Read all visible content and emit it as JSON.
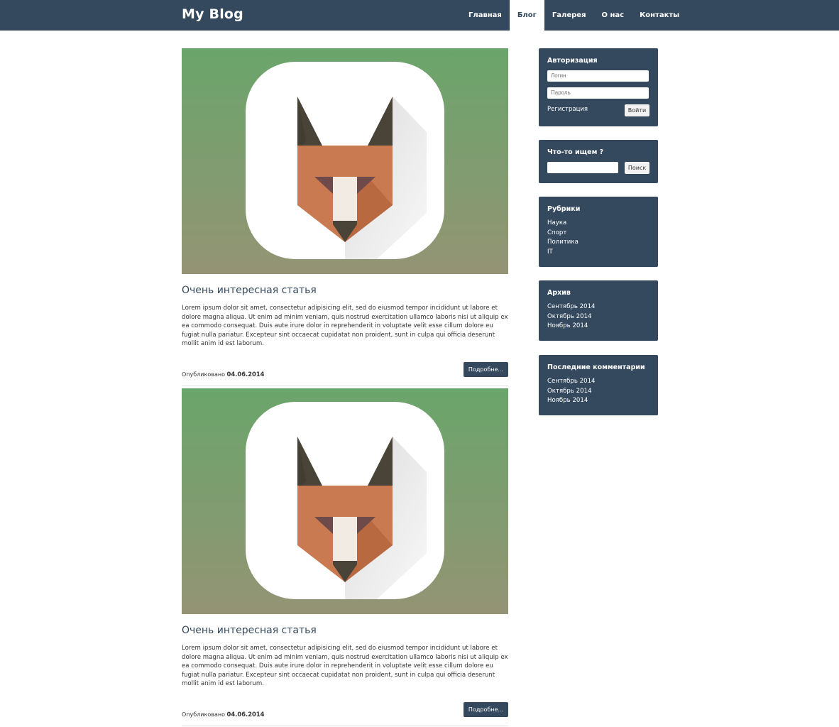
{
  "header": {
    "brand": "My Blog",
    "nav": [
      {
        "label": "Главная",
        "active": false
      },
      {
        "label": "Блог",
        "active": true
      },
      {
        "label": "Галерея",
        "active": false
      },
      {
        "label": "О нас",
        "active": false
      },
      {
        "label": "Контакты",
        "active": false
      }
    ]
  },
  "posts": [
    {
      "title": "Очень интересная статья",
      "text": "Lorem ipsum dolor sit amet, consectetur adipisicing elit, sed do eiusmod tempor incididunt ut labore et dolore magna aliqua. Ut enim ad minim veniam, quis nostrud exercitation ullamco laboris nisi ut aliquip ex ea commodo consequat. Duis aute irure dolor in reprehenderit in voluptate velit esse cillum dolore eu fugiat nulla pariatur. Excepteur sint occaecat cupidatat non proident, sunt in culpa qui officia deserunt mollit anim id est laborum.",
      "published_label": "Опубликовано",
      "date": "04.06.2014",
      "more_label": "Подробне..."
    },
    {
      "title": "Очень интересная статья",
      "text": "Lorem ipsum dolor sit amet, consectetur adipisicing elit, sed do eiusmod tempor incididunt ut labore et dolore magna aliqua. Ut enim ad minim veniam, quis nostrud exercitation ullamco laboris nisi ut aliquip ex ea commodo consequat. Duis aute irure dolor in reprehenderit in voluptate velit esse cillum dolore eu fugiat nulla pariatur. Excepteur sint occaecat cupidatat non proident, sunt in culpa qui officia deserunt mollit anim id est laborum.",
      "published_label": "Опубликовано",
      "date": "04.06.2014",
      "more_label": "Подробне..."
    }
  ],
  "sidebar": {
    "auth": {
      "title": "Авторизация",
      "login_placeholder": "Логин",
      "password_placeholder": "Пароль",
      "register_label": "Регистрация",
      "submit_label": "Войти"
    },
    "search": {
      "title": "Что-то ищем ?",
      "button_label": "Поиск"
    },
    "categories": {
      "title": "Рубрики",
      "items": [
        "Наука",
        "Спорт",
        "Политика",
        "IT"
      ]
    },
    "archive": {
      "title": "Архив",
      "items": [
        "Сентябрь 2014",
        "Октябрь 2014",
        "Ноябрь 2014"
      ]
    },
    "comments": {
      "title": "Последние комментарии",
      "items": [
        "Сентябрь 2014",
        "Октябрь 2014",
        "Ноябрь 2014"
      ]
    }
  },
  "colors": {
    "navbar": "#34495e",
    "widget": "#34495e",
    "image_top": "#6aa56b",
    "image_bottom": "#949474",
    "fox_ear": "#4a4438",
    "fox_face": "#c97a50"
  },
  "icons": [
    "fox-app-icon"
  ]
}
